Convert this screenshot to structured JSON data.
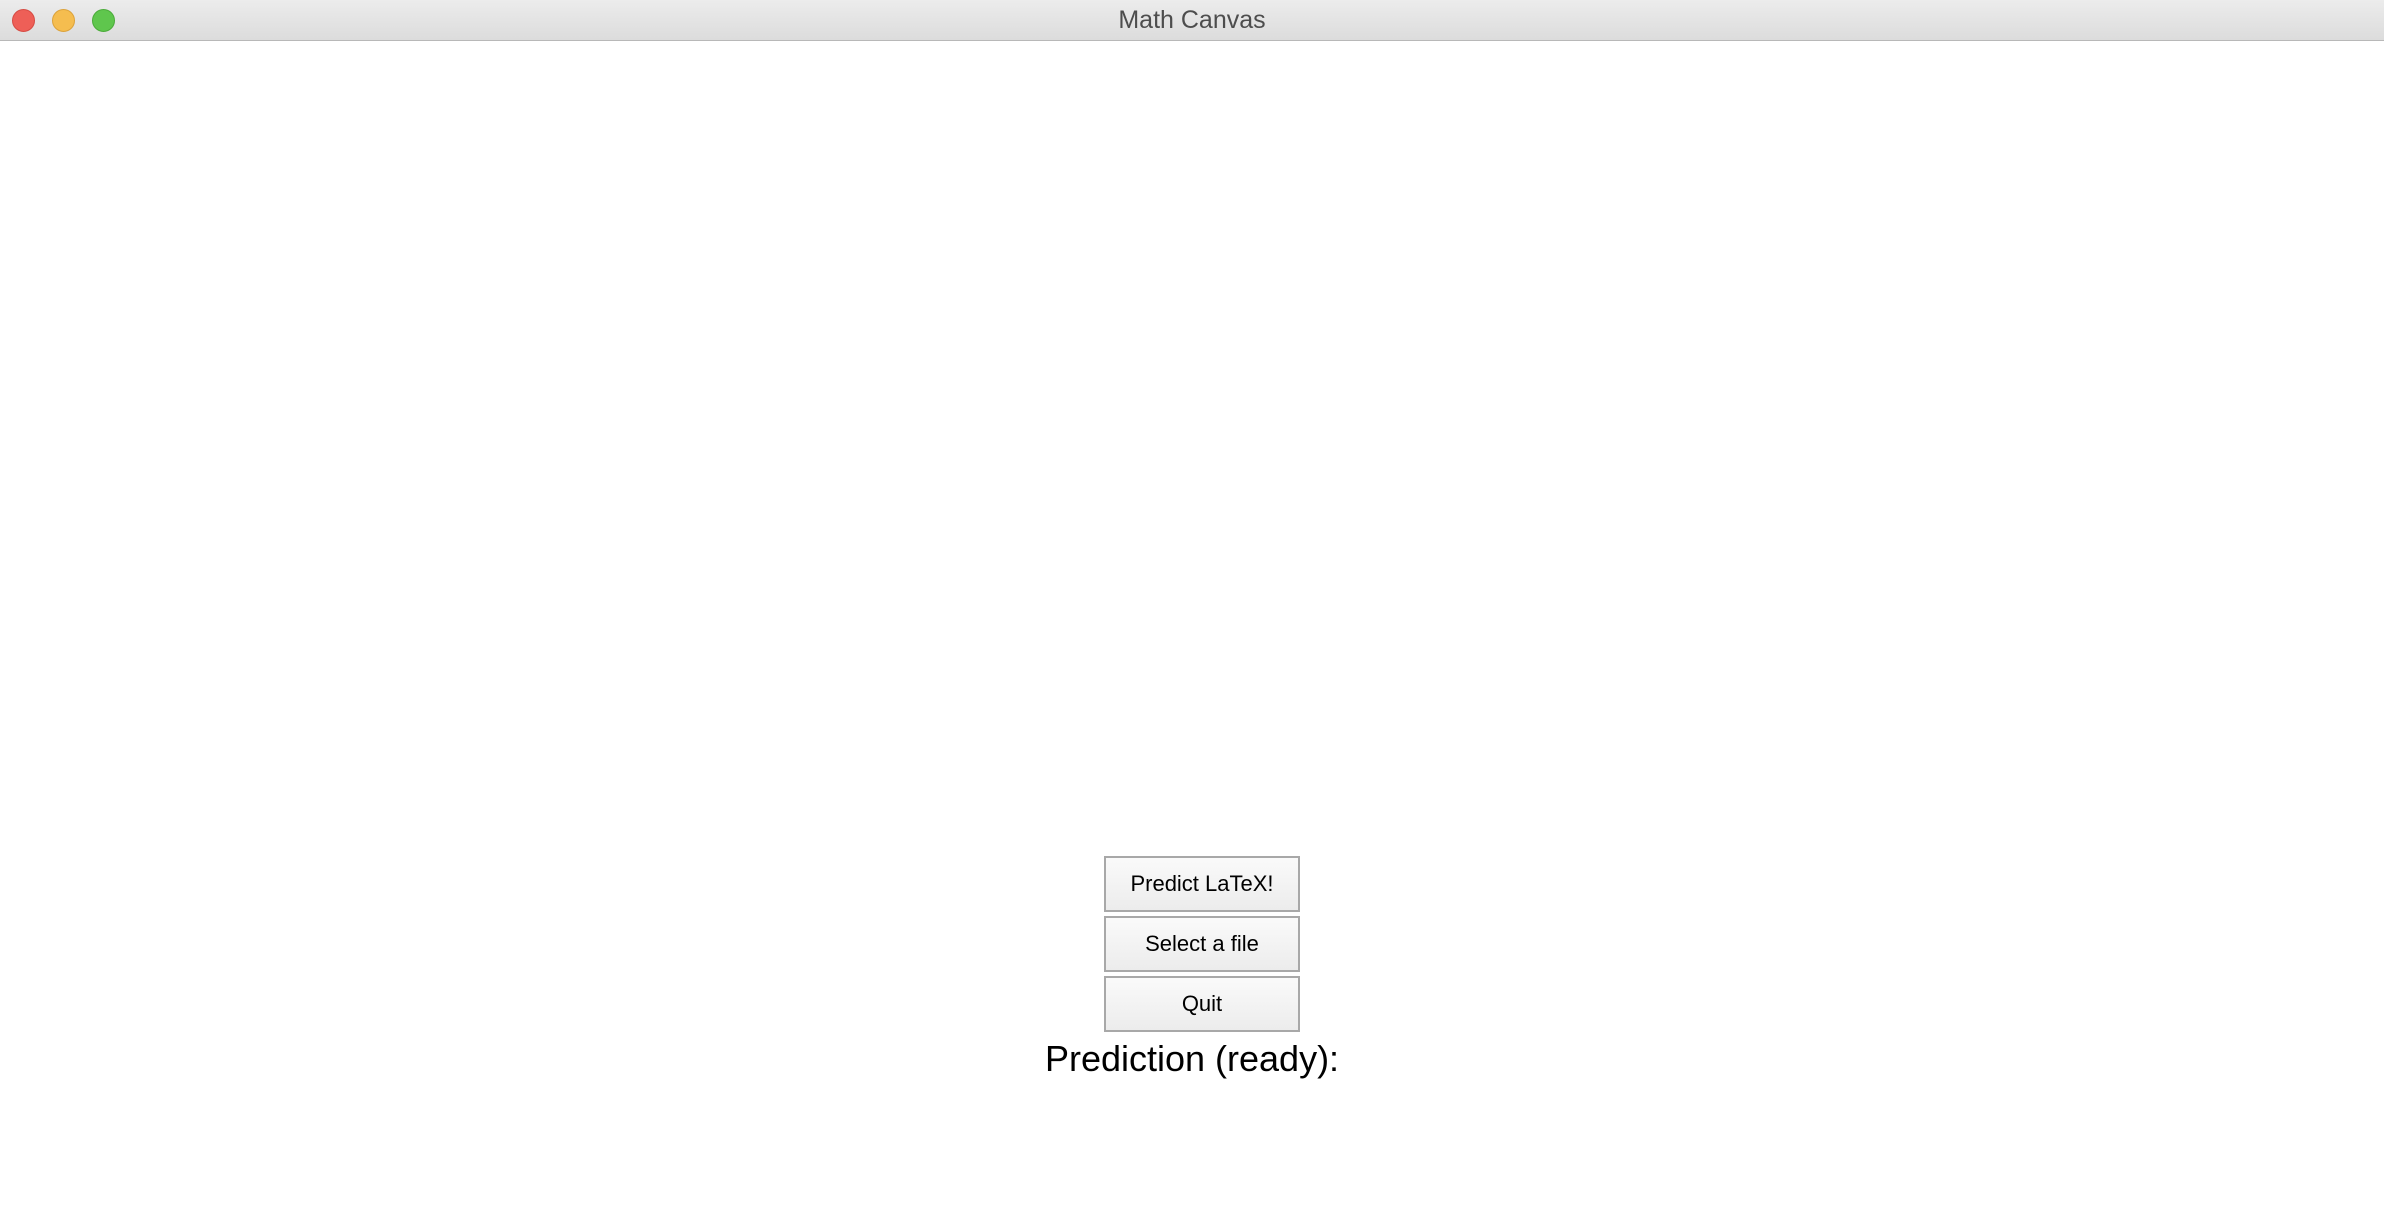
{
  "window": {
    "title": "Math Canvas"
  },
  "buttons": {
    "predict_label": "Predict LaTeX!",
    "select_file_label": "Select a file",
    "quit_label": "Quit"
  },
  "prediction": {
    "label": "Prediction (ready):"
  },
  "colors": {
    "close": "#ee5f57",
    "minimize": "#f5bd4f",
    "maximize": "#5fc64d",
    "background": "#ffffff"
  }
}
